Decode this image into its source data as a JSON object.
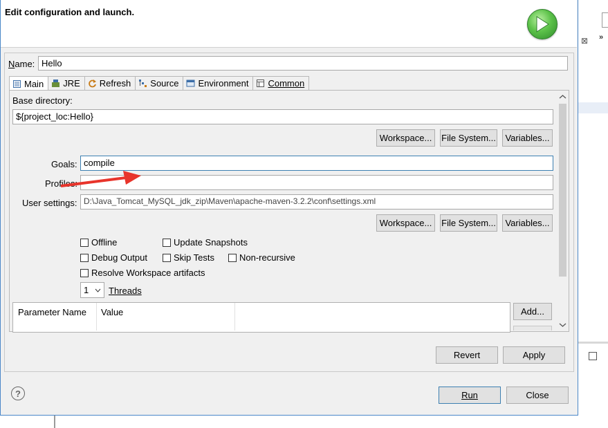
{
  "header": {
    "title": "Edit configuration and launch."
  },
  "name": {
    "label": "Name:",
    "value": "Hello"
  },
  "tabs": [
    {
      "label": "Main",
      "icon": "main-tab-icon"
    },
    {
      "label": "JRE",
      "icon": "jre-icon"
    },
    {
      "label": "Refresh",
      "icon": "refresh-icon"
    },
    {
      "label": "Source",
      "icon": "source-icon"
    },
    {
      "label": "Environment",
      "icon": "environment-icon"
    },
    {
      "label": "Common",
      "icon": "common-icon"
    }
  ],
  "base_dir": {
    "label": "Base directory:",
    "value": "${project_loc:Hello}"
  },
  "buttons1": {
    "workspace": "Workspace...",
    "filesystem": "File System...",
    "variables": "Variables..."
  },
  "goals": {
    "label": "Goals:",
    "value": "compile"
  },
  "profiles": {
    "label": "Profiles:",
    "value": ""
  },
  "user_settings": {
    "label": "User settings:",
    "value": "D:\\Java_Tomcat_MySQL_jdk_zip\\Maven\\apache-maven-3.2.2\\conf\\settings.xml"
  },
  "buttons2": {
    "workspace": "Workspace...",
    "filesystem": "File System...",
    "variables": "Variables..."
  },
  "options": {
    "offline": "Offline",
    "update_snapshots": "Update Snapshots",
    "debug_output": "Debug Output",
    "skip_tests": "Skip Tests",
    "non_recursive": "Non-recursive",
    "resolve_workspace": "Resolve Workspace artifacts"
  },
  "threads": {
    "value": "1",
    "label": "Threads"
  },
  "params_table": {
    "columns": [
      "Parameter Name",
      "Value"
    ],
    "add_label": "Add..."
  },
  "footer": {
    "revert": "Revert",
    "apply": "Apply",
    "run": "Run",
    "close": "Close"
  },
  "colors": {
    "accent": "#4a87c8",
    "arrow": "#e8342b",
    "run_green": "#5dc24a"
  }
}
